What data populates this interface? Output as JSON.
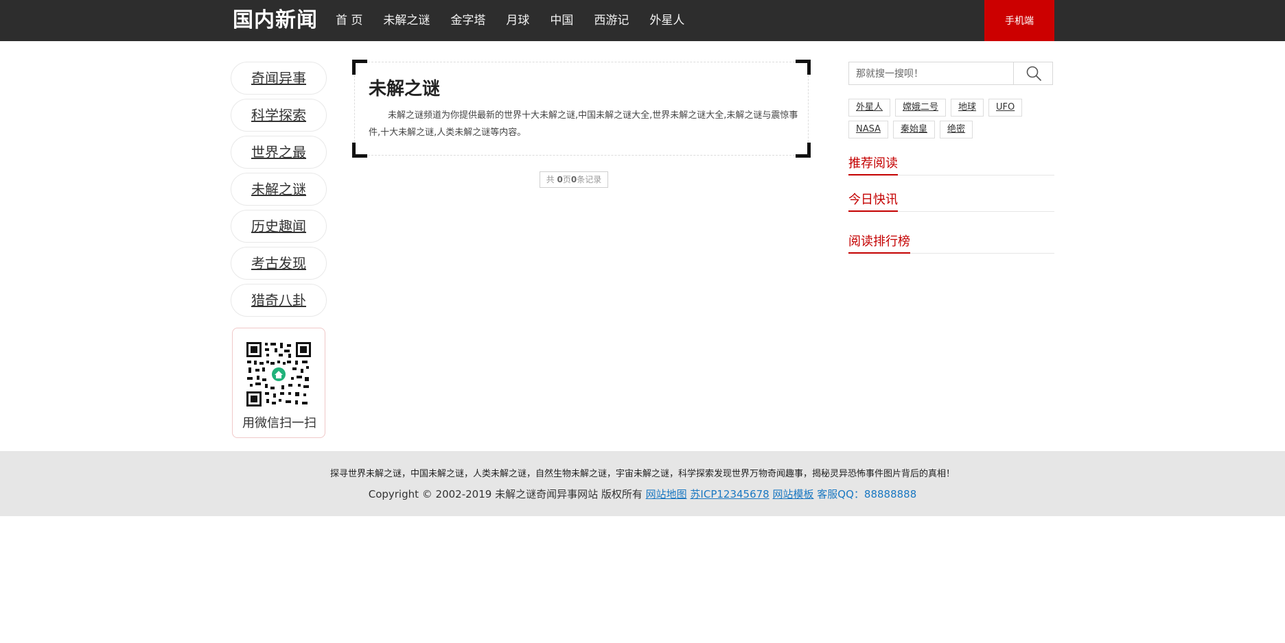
{
  "header": {
    "logo": "国内新闻",
    "nav": [
      "首 页",
      "未解之谜",
      "金字塔",
      "月球",
      "中国",
      "西游记",
      "外星人"
    ],
    "mobile_label": "手机端"
  },
  "sidebar": {
    "categories": [
      "奇闻异事",
      "科学探索",
      "世界之最",
      "未解之谜",
      "历史趣闻",
      "考古发现",
      "猎奇八卦"
    ],
    "qr_label": "用微信扫一扫"
  },
  "main": {
    "title": "未解之谜",
    "description": "未解之谜频道为你提供最新的世界十大未解之谜,中国未解之谜大全,世界未解之谜大全,未解之谜与震惊事件,十大未解之谜,人类未解之谜等内容。",
    "pager": {
      "prefix": "共 ",
      "pages": "0",
      "mid": "页",
      "records": "0",
      "suffix": "条记录"
    }
  },
  "right": {
    "search_placeholder": "那就搜一搜呗！",
    "tags": [
      "外星人",
      "嫦娥二号",
      "地球",
      "UFO",
      "NASA",
      "秦始皇",
      "绝密"
    ],
    "sections": [
      "推荐阅读",
      "今日快讯",
      "阅读排行榜"
    ]
  },
  "footer": {
    "tagline": "探寻世界未解之谜，中国未解之谜，人类未解之谜，自然生物未解之谜，宇宙未解之谜，科学探索发现世界万物奇闻趣事，揭秘灵异恐怖事件图片背后的真相！",
    "copyright": "Copyright © 2002-2019 未解之谜奇闻异事网站 版权所有 ",
    "links": [
      "网站地图",
      "苏ICP12345678",
      "网站模板"
    ],
    "qq": "客服QQ：88888888"
  },
  "colors": {
    "header_bg": "#2d2d2d",
    "accent_red": "#cc0000",
    "link_blue": "#1a78c2",
    "footer_bg": "#e6e6e6"
  }
}
